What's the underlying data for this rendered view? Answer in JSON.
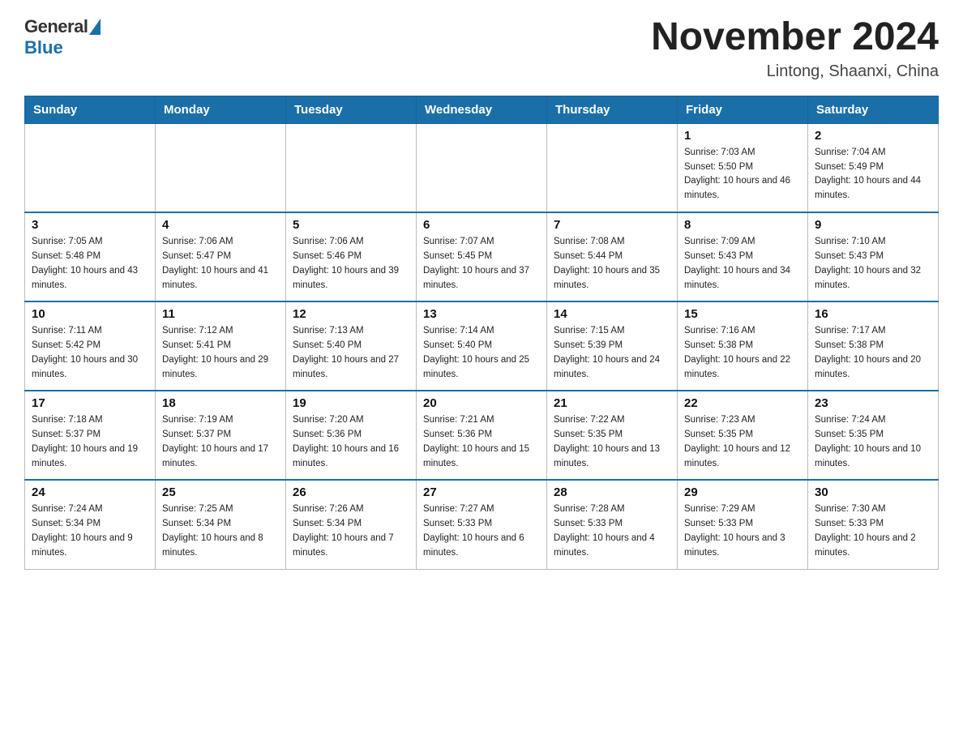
{
  "header": {
    "logo_text": "General",
    "logo_blue": "Blue",
    "month_title": "November 2024",
    "subtitle": "Lintong, Shaanxi, China"
  },
  "days_of_week": [
    "Sunday",
    "Monday",
    "Tuesday",
    "Wednesday",
    "Thursday",
    "Friday",
    "Saturday"
  ],
  "weeks": [
    [
      {
        "day": "",
        "info": ""
      },
      {
        "day": "",
        "info": ""
      },
      {
        "day": "",
        "info": ""
      },
      {
        "day": "",
        "info": ""
      },
      {
        "day": "",
        "info": ""
      },
      {
        "day": "1",
        "info": "Sunrise: 7:03 AM\nSunset: 5:50 PM\nDaylight: 10 hours and 46 minutes."
      },
      {
        "day": "2",
        "info": "Sunrise: 7:04 AM\nSunset: 5:49 PM\nDaylight: 10 hours and 44 minutes."
      }
    ],
    [
      {
        "day": "3",
        "info": "Sunrise: 7:05 AM\nSunset: 5:48 PM\nDaylight: 10 hours and 43 minutes."
      },
      {
        "day": "4",
        "info": "Sunrise: 7:06 AM\nSunset: 5:47 PM\nDaylight: 10 hours and 41 minutes."
      },
      {
        "day": "5",
        "info": "Sunrise: 7:06 AM\nSunset: 5:46 PM\nDaylight: 10 hours and 39 minutes."
      },
      {
        "day": "6",
        "info": "Sunrise: 7:07 AM\nSunset: 5:45 PM\nDaylight: 10 hours and 37 minutes."
      },
      {
        "day": "7",
        "info": "Sunrise: 7:08 AM\nSunset: 5:44 PM\nDaylight: 10 hours and 35 minutes."
      },
      {
        "day": "8",
        "info": "Sunrise: 7:09 AM\nSunset: 5:43 PM\nDaylight: 10 hours and 34 minutes."
      },
      {
        "day": "9",
        "info": "Sunrise: 7:10 AM\nSunset: 5:43 PM\nDaylight: 10 hours and 32 minutes."
      }
    ],
    [
      {
        "day": "10",
        "info": "Sunrise: 7:11 AM\nSunset: 5:42 PM\nDaylight: 10 hours and 30 minutes."
      },
      {
        "day": "11",
        "info": "Sunrise: 7:12 AM\nSunset: 5:41 PM\nDaylight: 10 hours and 29 minutes."
      },
      {
        "day": "12",
        "info": "Sunrise: 7:13 AM\nSunset: 5:40 PM\nDaylight: 10 hours and 27 minutes."
      },
      {
        "day": "13",
        "info": "Sunrise: 7:14 AM\nSunset: 5:40 PM\nDaylight: 10 hours and 25 minutes."
      },
      {
        "day": "14",
        "info": "Sunrise: 7:15 AM\nSunset: 5:39 PM\nDaylight: 10 hours and 24 minutes."
      },
      {
        "day": "15",
        "info": "Sunrise: 7:16 AM\nSunset: 5:38 PM\nDaylight: 10 hours and 22 minutes."
      },
      {
        "day": "16",
        "info": "Sunrise: 7:17 AM\nSunset: 5:38 PM\nDaylight: 10 hours and 20 minutes."
      }
    ],
    [
      {
        "day": "17",
        "info": "Sunrise: 7:18 AM\nSunset: 5:37 PM\nDaylight: 10 hours and 19 minutes."
      },
      {
        "day": "18",
        "info": "Sunrise: 7:19 AM\nSunset: 5:37 PM\nDaylight: 10 hours and 17 minutes."
      },
      {
        "day": "19",
        "info": "Sunrise: 7:20 AM\nSunset: 5:36 PM\nDaylight: 10 hours and 16 minutes."
      },
      {
        "day": "20",
        "info": "Sunrise: 7:21 AM\nSunset: 5:36 PM\nDaylight: 10 hours and 15 minutes."
      },
      {
        "day": "21",
        "info": "Sunrise: 7:22 AM\nSunset: 5:35 PM\nDaylight: 10 hours and 13 minutes."
      },
      {
        "day": "22",
        "info": "Sunrise: 7:23 AM\nSunset: 5:35 PM\nDaylight: 10 hours and 12 minutes."
      },
      {
        "day": "23",
        "info": "Sunrise: 7:24 AM\nSunset: 5:35 PM\nDaylight: 10 hours and 10 minutes."
      }
    ],
    [
      {
        "day": "24",
        "info": "Sunrise: 7:24 AM\nSunset: 5:34 PM\nDaylight: 10 hours and 9 minutes."
      },
      {
        "day": "25",
        "info": "Sunrise: 7:25 AM\nSunset: 5:34 PM\nDaylight: 10 hours and 8 minutes."
      },
      {
        "day": "26",
        "info": "Sunrise: 7:26 AM\nSunset: 5:34 PM\nDaylight: 10 hours and 7 minutes."
      },
      {
        "day": "27",
        "info": "Sunrise: 7:27 AM\nSunset: 5:33 PM\nDaylight: 10 hours and 6 minutes."
      },
      {
        "day": "28",
        "info": "Sunrise: 7:28 AM\nSunset: 5:33 PM\nDaylight: 10 hours and 4 minutes."
      },
      {
        "day": "29",
        "info": "Sunrise: 7:29 AM\nSunset: 5:33 PM\nDaylight: 10 hours and 3 minutes."
      },
      {
        "day": "30",
        "info": "Sunrise: 7:30 AM\nSunset: 5:33 PM\nDaylight: 10 hours and 2 minutes."
      }
    ]
  ]
}
